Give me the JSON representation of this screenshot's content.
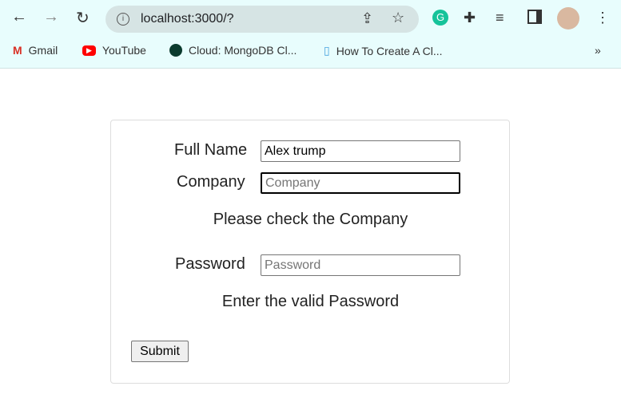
{
  "browser": {
    "url": "localhost:3000/?",
    "bookmarks": [
      "Gmail",
      "YouTube",
      "Cloud: MongoDB Cl...",
      "How To Create A Cl..."
    ],
    "more": "»"
  },
  "form": {
    "full_name_label": "Full Name",
    "full_name_value": "Alex trump",
    "company_label": "Company",
    "company_placeholder": "Company",
    "company_error": "Please check the Company",
    "password_label": "Password",
    "password_placeholder": "Password",
    "password_error": "Enter the valid Password",
    "submit_label": "Submit"
  }
}
